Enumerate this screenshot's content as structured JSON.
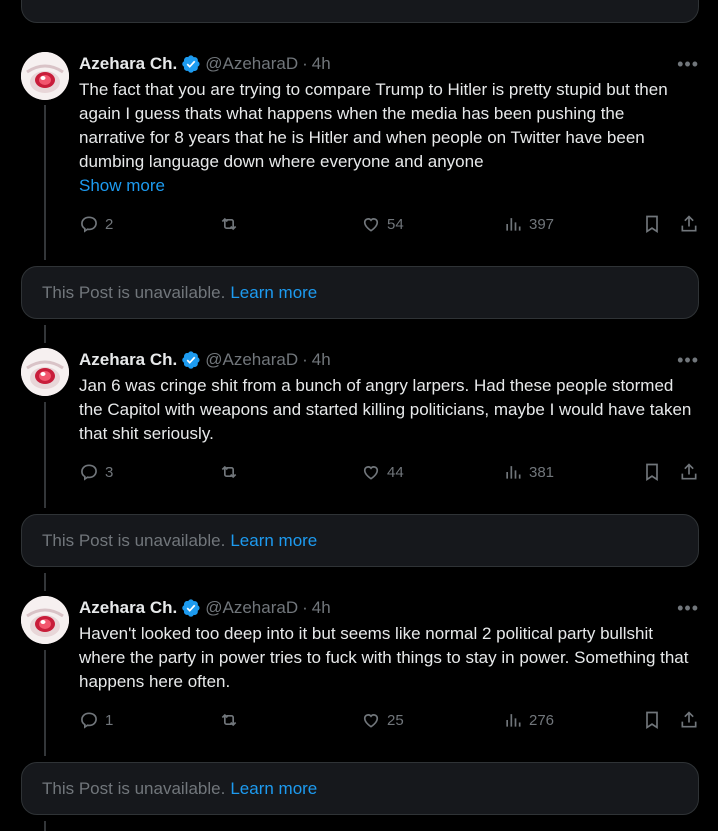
{
  "colors": {
    "background": "#000000",
    "text": "#e7e9ea",
    "muted": "#71767b",
    "accent": "#1d9bf0",
    "card": "#16181c",
    "border": "#2f3336"
  },
  "unavailable": {
    "text": "This Post is unavailable.",
    "link": "Learn more"
  },
  "tweets": [
    {
      "author": "Azehara Ch.",
      "handle": "@AzeharaD",
      "dot": "·",
      "time": "4h",
      "text": "The fact that you are trying to compare Trump to Hitler is pretty stupid but then again I guess thats what happens when the media has been pushing the narrative for 8 years that he is Hitler and when people on Twitter have been dumbing language down where everyone and anyone",
      "show_more": "Show more",
      "replies": "2",
      "reposts": "",
      "likes": "54",
      "views": "397"
    },
    {
      "author": "Azehara Ch.",
      "handle": "@AzeharaD",
      "dot": "·",
      "time": "4h",
      "text": "Jan 6 was cringe shit from a bunch of angry larpers.  Had these people stormed the Capitol with weapons and started killing politicians, maybe I would have taken that shit seriously.",
      "replies": "3",
      "reposts": "",
      "likes": "44",
      "views": "381"
    },
    {
      "author": "Azehara Ch.",
      "handle": "@AzeharaD",
      "dot": "·",
      "time": "4h",
      "text": "Haven't looked too deep into it but seems like normal 2 political party bullshit where the party in power tries to fuck with things to stay in power. Something that happens here often.",
      "replies": "1",
      "reposts": "",
      "likes": "25",
      "views": "276"
    }
  ],
  "icons": {
    "more": "•••"
  }
}
